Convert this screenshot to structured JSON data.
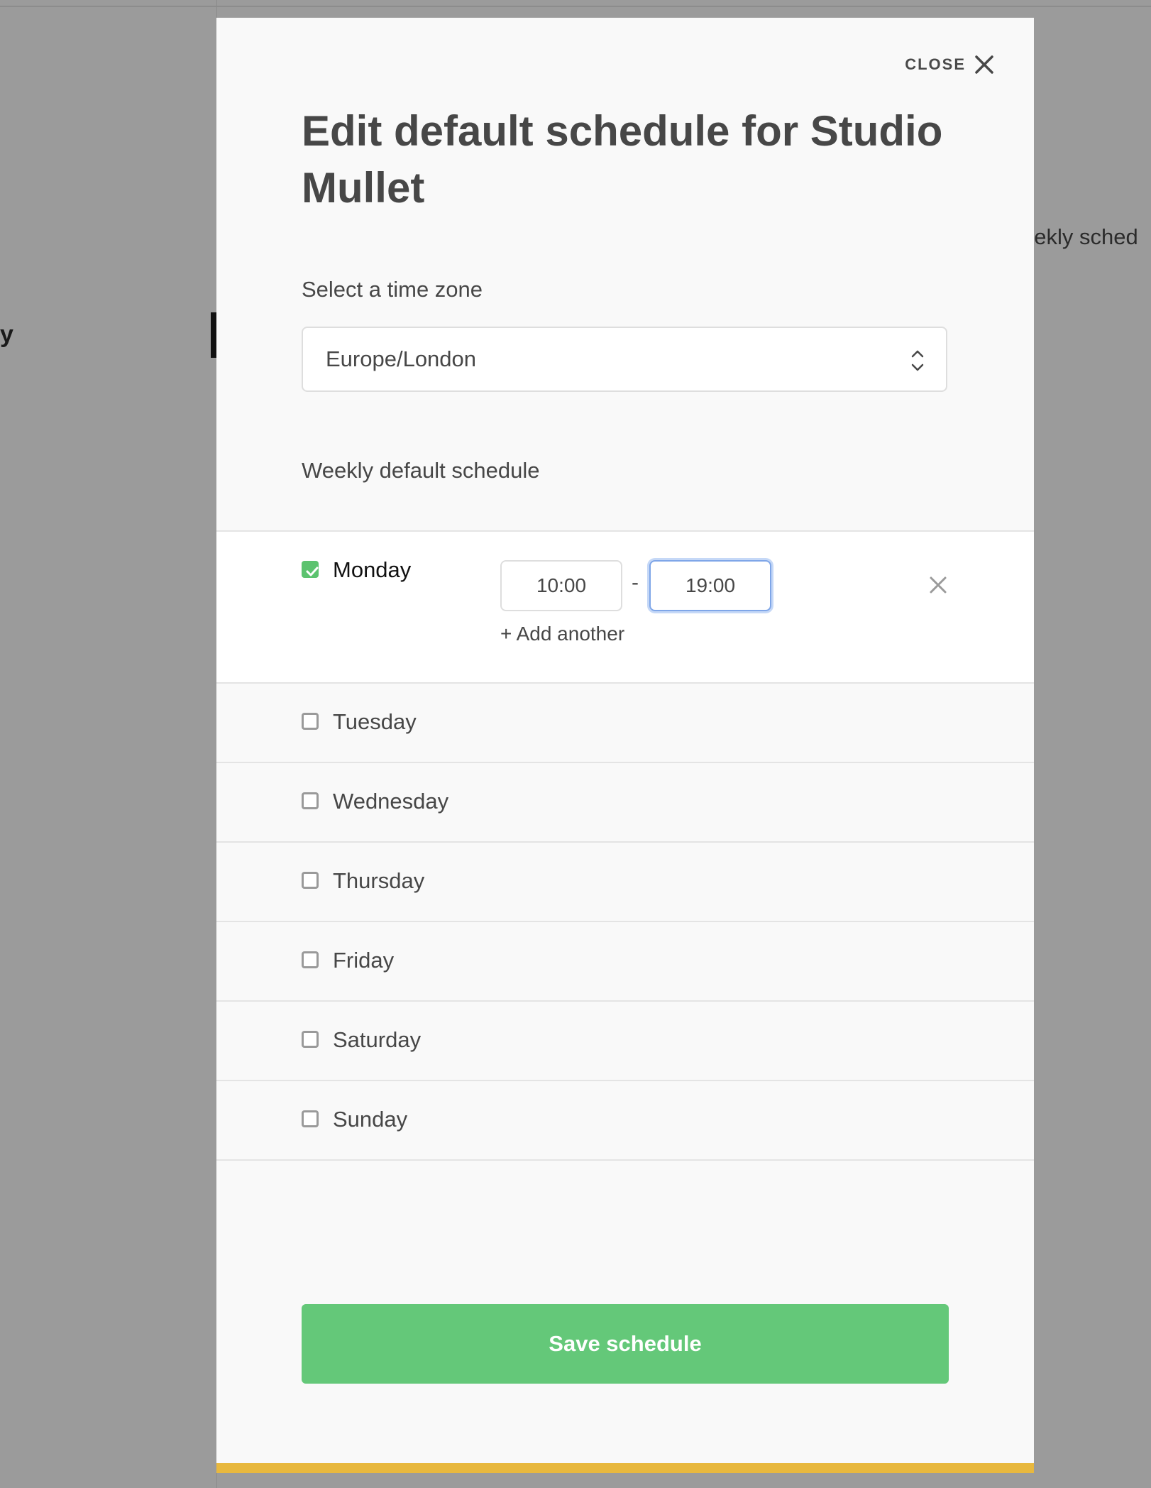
{
  "background": {
    "left_fragment": "y",
    "right_fragment": "eekly sched"
  },
  "modal": {
    "close_label": "CLOSE",
    "title": "Edit default schedule for Studio Mullet",
    "timezone": {
      "label": "Select a time zone",
      "selected": "Europe/London"
    },
    "weekly": {
      "label": "Weekly default schedule",
      "days": [
        {
          "name": "Monday",
          "checked": true,
          "start": "10:00",
          "separator": "-",
          "end": "19:00",
          "add_label": "+ Add another"
        },
        {
          "name": "Tuesday",
          "checked": false
        },
        {
          "name": "Wednesday",
          "checked": false
        },
        {
          "name": "Thursday",
          "checked": false
        },
        {
          "name": "Friday",
          "checked": false
        },
        {
          "name": "Saturday",
          "checked": false
        },
        {
          "name": "Sunday",
          "checked": false
        }
      ]
    },
    "save_label": "Save schedule"
  },
  "colors": {
    "accent_green": "#64c879",
    "checkbox_green": "#5cc36f",
    "bottom_bar": "#e8b83e",
    "overlay": "#9b9b9b",
    "focus_blue": "#7fa6e8"
  }
}
